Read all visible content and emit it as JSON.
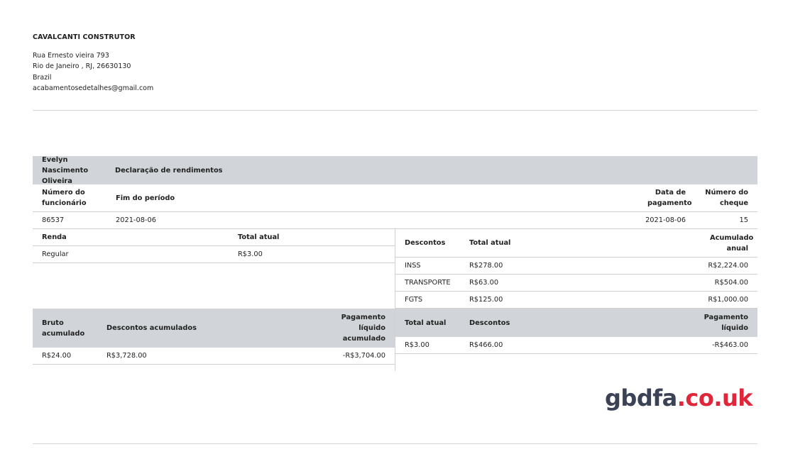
{
  "company": {
    "name": "CAVALCANTI CONSTRUTOR",
    "address_line1": "Rua Ernesto vieira 793",
    "address_line2": "Rio de Janeiro , RJ, 26630130",
    "country": "Brazil",
    "email": "acabamentosedetalhes@gmail.com"
  },
  "statement": {
    "employee_name": "Evelyn Nascimento Oliveira",
    "title": "Declaração de rendimentos",
    "headers": {
      "employee_number": "Número do funcionário",
      "period_end": "Fim do período",
      "payment_date": "Data de pagamento",
      "check_number": "Número do cheque"
    },
    "values": {
      "employee_number": "86537",
      "period_end": "2021-08-06",
      "payment_date": "2021-08-06",
      "check_number": "15"
    }
  },
  "income": {
    "headers": {
      "type": "Renda",
      "current": "Total atual"
    },
    "rows": [
      {
        "type": "Regular",
        "current": "R$3.00"
      }
    ]
  },
  "deductions": {
    "headers": {
      "type": "Descontos",
      "current": "Total atual",
      "ytd": "Acumulado anual"
    },
    "rows": [
      {
        "type": "INSS",
        "current": "R$278.00",
        "ytd": "R$2,224.00"
      },
      {
        "type": "TRANSPORTE",
        "current": "R$63.00",
        "ytd": "R$504.00"
      },
      {
        "type": "FGTS",
        "current": "R$125.00",
        "ytd": "R$1,000.00"
      }
    ]
  },
  "ytd_summary": {
    "headers": {
      "gross": "Bruto acumulado",
      "deductions": "Descontos acumulados",
      "net": "Pagamento líquido acumulado"
    },
    "values": {
      "gross": "R$24.00",
      "deductions": "R$3,728.00",
      "net": "-R$3,704.00"
    }
  },
  "current_summary": {
    "headers": {
      "total": "Total atual",
      "deductions": "Descontos",
      "net": "Pagamento líquido"
    },
    "values": {
      "total": "R$3.00",
      "deductions": "R$466.00",
      "net": "-R$463.00"
    }
  },
  "watermark": {
    "part1": "gbdfa",
    "part2": ".co.uk",
    "color_dark": "#3b4256",
    "color_red": "#e0263a"
  }
}
